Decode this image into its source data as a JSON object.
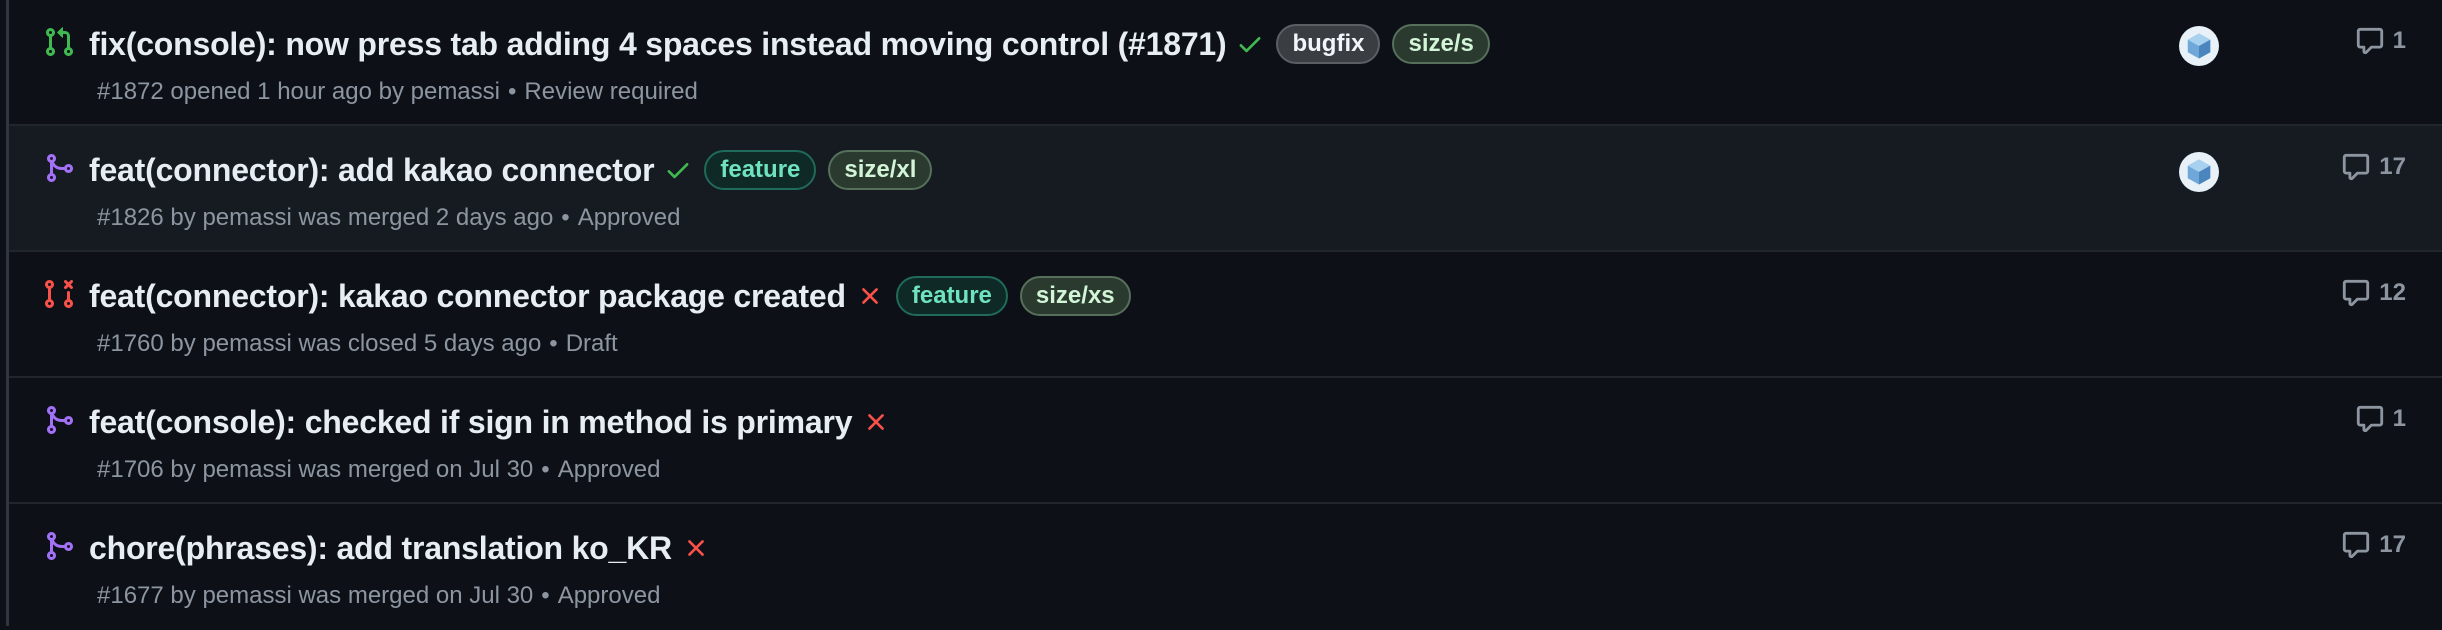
{
  "colors": {
    "background": "#0d1117",
    "open_green": "#3fb950",
    "merged_purple": "#a371f7",
    "closed_red": "#f85149",
    "check_green": "#3fb950",
    "cross_red": "#f85149"
  },
  "pull_requests": [
    {
      "state": "open",
      "state_icon": "git-pull-request-icon",
      "title": "fix(console): now press tab adding 4 spaces instead moving control (#1871)",
      "status": "success",
      "labels": [
        {
          "text": "bugfix",
          "kind": "bugfix"
        },
        {
          "text": "size/s",
          "kind": "size"
        }
      ],
      "number": "#1872",
      "meta": "opened 1 hour ago by pemassi",
      "review": "Review required",
      "has_assignee": true,
      "comments": "1"
    },
    {
      "state": "merged",
      "state_icon": "git-merge-icon",
      "title": "feat(connector): add kakao connector",
      "status": "success",
      "labels": [
        {
          "text": "feature",
          "kind": "feature"
        },
        {
          "text": "size/xl",
          "kind": "size"
        }
      ],
      "number": "#1826",
      "meta": "by pemassi was merged 2 days ago",
      "review": "Approved",
      "has_assignee": true,
      "comments": "17"
    },
    {
      "state": "closed",
      "state_icon": "git-pull-request-closed-icon",
      "title": "feat(connector): kakao connector package created",
      "status": "failure",
      "labels": [
        {
          "text": "feature",
          "kind": "feature"
        },
        {
          "text": "size/xs",
          "kind": "size"
        }
      ],
      "number": "#1760",
      "meta": "by pemassi was closed 5 days ago",
      "review": "Draft",
      "has_assignee": false,
      "comments": "12"
    },
    {
      "state": "merged",
      "state_icon": "git-merge-icon",
      "title": "feat(console): checked if sign in method is primary",
      "status": "failure",
      "labels": [],
      "number": "#1706",
      "meta": "by pemassi was merged on Jul 30",
      "review": "Approved",
      "has_assignee": false,
      "comments": "1"
    },
    {
      "state": "merged",
      "state_icon": "git-merge-icon",
      "title": "chore(phrases): add translation ko_KR",
      "status": "failure",
      "labels": [],
      "number": "#1677",
      "meta": "by pemassi was merged on Jul 30",
      "review": "Approved",
      "has_assignee": false,
      "comments": "17"
    }
  ]
}
